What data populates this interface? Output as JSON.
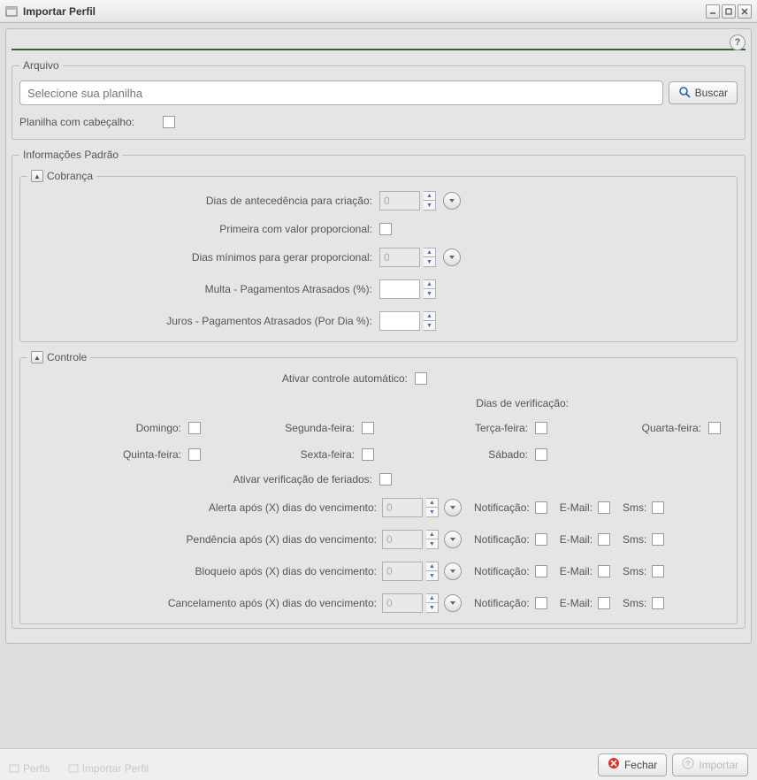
{
  "window": {
    "title": "Importar Perfil"
  },
  "arquivo": {
    "legend": "Arquivo",
    "placeholder": "Selecione sua planilha",
    "buscar": "Buscar",
    "planilha_label": "Planilha com cabeçalho:"
  },
  "info": {
    "legend": "Informações Padrão",
    "cobranca": {
      "legend": "Cobrança",
      "dias_antecedencia_label": "Dias de antecedência para criação:",
      "dias_antecedencia_value": "0",
      "primeira_proporcional_label": "Primeira com valor proporcional:",
      "dias_minimos_label": "Dias mínimos para gerar proporcional:",
      "dias_minimos_value": "0",
      "multa_label": "Multa - Pagamentos Atrasados (%):",
      "multa_value": "",
      "juros_label": "Juros - Pagamentos Atrasados (Por Dia %):",
      "juros_value": ""
    },
    "controle": {
      "legend": "Controle",
      "ativar_auto_label": "Ativar controle automático:",
      "dias_verificacao_label": "Dias de verificação:",
      "days": {
        "domingo": "Domingo:",
        "segunda": "Segunda-feira:",
        "terca": "Terça-feira:",
        "quarta": "Quarta-feira:",
        "quinta": "Quinta-feira:",
        "sexta": "Sexta-feira:",
        "sabado": "Sábado:"
      },
      "ativar_feriados_label": "Ativar verificação de feriados:",
      "alerta_label": "Alerta após (X) dias do vencimento:",
      "alerta_value": "0",
      "pendencia_label": "Pendência após (X) dias do vencimento:",
      "pendencia_value": "0",
      "bloqueio_label": "Bloqueio após (X) dias do vencimento:",
      "bloqueio_value": "0",
      "cancelamento_label": "Cancelamento após (X) dias do vencimento:",
      "cancelamento_value": "0",
      "notificacao_label": "Notificação:",
      "email_label": "E-Mail:",
      "sms_label": "Sms:"
    }
  },
  "footer": {
    "tab_perfis": "Perfis",
    "tab_importar": "Importar Perfil",
    "fechar": "Fechar",
    "importar": "Importar"
  }
}
